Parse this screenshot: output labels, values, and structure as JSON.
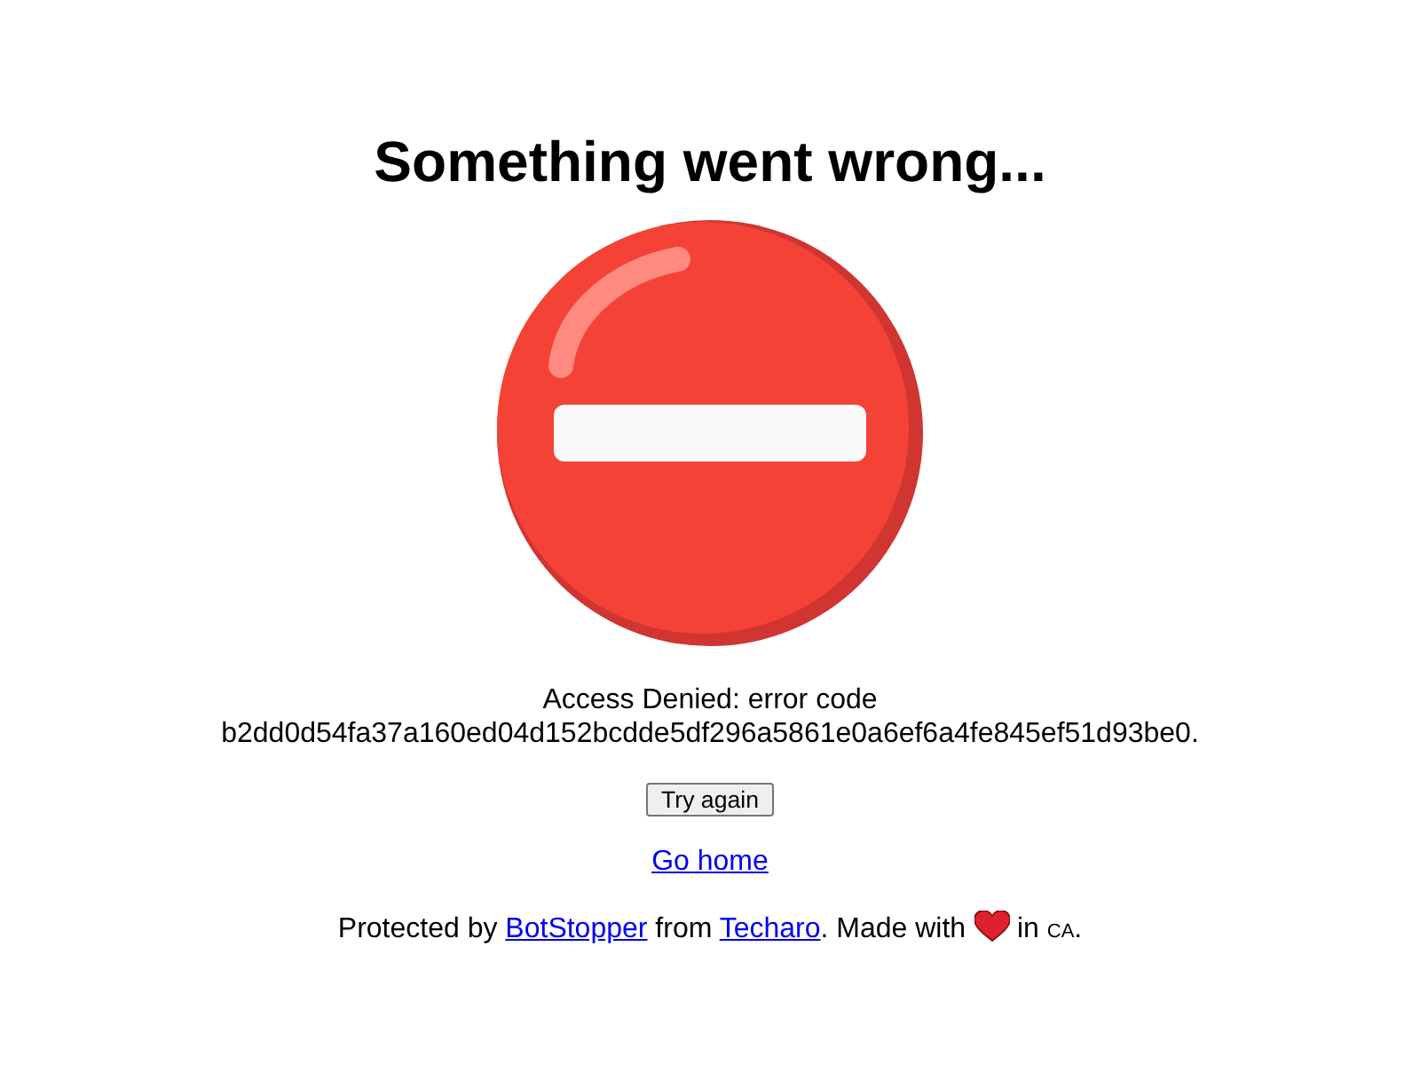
{
  "title": "Something went wrong...",
  "message": [
    "Access Denied: error code",
    "b2dd0d54fa37a160ed04d152bcdde5df296a5861e0a6ef6a4fe845ef51d93be0."
  ],
  "retry_button": "Try again",
  "home_link": "Go home",
  "footer": [
    {
      "kind": "text",
      "text": "Protected by "
    },
    {
      "kind": "link",
      "text": "BotStopper"
    },
    {
      "kind": "text",
      "text": " from "
    },
    {
      "kind": "link",
      "text": "Techaro"
    },
    {
      "kind": "text",
      "text": ". Made with "
    },
    {
      "kind": "heart"
    },
    {
      "kind": "text",
      "text": " in "
    },
    {
      "kind": "smallcaps",
      "text": "CA"
    },
    {
      "kind": "text",
      "text": "."
    }
  ]
}
